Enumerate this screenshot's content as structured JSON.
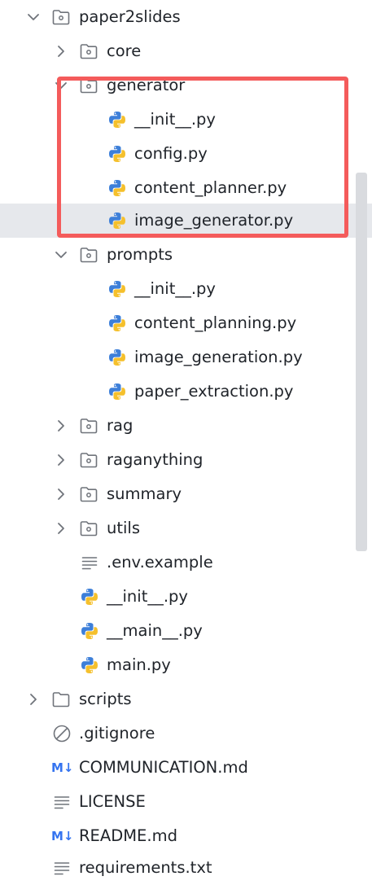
{
  "tree": {
    "root": {
      "label": "paper2slides",
      "expanded": true,
      "icon": "folder-icon"
    },
    "core": {
      "label": "core",
      "expanded": false,
      "icon": "folder-icon"
    },
    "generator": {
      "label": "generator",
      "expanded": true,
      "icon": "folder-icon",
      "files": [
        {
          "label": "__init__.py",
          "icon": "python-icon"
        },
        {
          "label": "config.py",
          "icon": "python-icon"
        },
        {
          "label": "content_planner.py",
          "icon": "python-icon"
        },
        {
          "label": "image_generator.py",
          "icon": "python-icon",
          "selected": true
        }
      ]
    },
    "prompts": {
      "label": "prompts",
      "expanded": true,
      "icon": "folder-icon",
      "files": [
        {
          "label": "__init__.py",
          "icon": "python-icon"
        },
        {
          "label": "content_planning.py",
          "icon": "python-icon"
        },
        {
          "label": "image_generation.py",
          "icon": "python-icon"
        },
        {
          "label": "paper_extraction.py",
          "icon": "python-icon"
        }
      ]
    },
    "collapsed_folders": [
      {
        "label": "rag",
        "icon": "folder-icon"
      },
      {
        "label": "raganything",
        "icon": "folder-icon"
      },
      {
        "label": "summary",
        "icon": "folder-icon"
      },
      {
        "label": "utils",
        "icon": "folder-icon"
      }
    ],
    "package_files": [
      {
        "label": ".env.example",
        "icon": "text-file-icon"
      },
      {
        "label": "__init__.py",
        "icon": "python-icon"
      },
      {
        "label": "__main__.py",
        "icon": "python-icon"
      },
      {
        "label": "main.py",
        "icon": "python-icon"
      }
    ],
    "scripts": {
      "label": "scripts",
      "expanded": false,
      "icon": "folder-plain-icon"
    },
    "top_files": [
      {
        "label": ".gitignore",
        "icon": "ignore-icon"
      },
      {
        "label": "COMMUNICATION.md",
        "icon": "markdown-icon",
        "badge": "M↓"
      },
      {
        "label": "LICENSE",
        "icon": "text-file-icon"
      },
      {
        "label": "README.md",
        "icon": "markdown-icon",
        "badge": "M↓"
      },
      {
        "label": "requirements.txt",
        "icon": "text-file-icon"
      }
    ]
  },
  "colors": {
    "highlight_box": "#f45b5b",
    "selected_row": "#e6e8ec",
    "python_blue": "#3d7fd9",
    "python_yellow": "#f5c02c",
    "markdown_blue": "#3574f0",
    "icon_gray": "#6f737a"
  }
}
